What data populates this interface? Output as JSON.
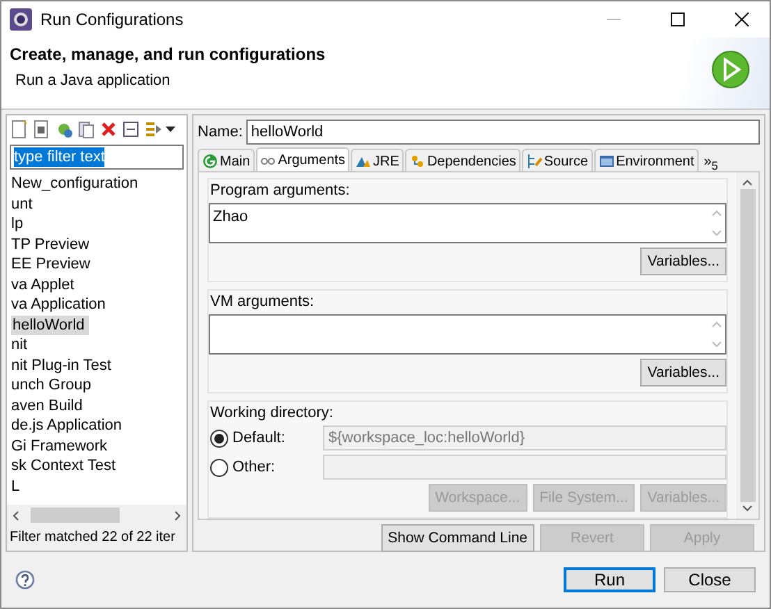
{
  "window": {
    "title": "Run Configurations"
  },
  "header": {
    "title": "Create, manage, and run configurations",
    "subtitle": "Run a Java application"
  },
  "sidebar": {
    "filter": {
      "placeholder": "type filter text"
    },
    "items": [
      {
        "label": "New_configuration",
        "selected": false
      },
      {
        "label": "unt",
        "selected": false
      },
      {
        "label": "lp",
        "selected": false
      },
      {
        "label": "TP Preview",
        "selected": false
      },
      {
        "label": "EE Preview",
        "selected": false
      },
      {
        "label": "va Applet",
        "selected": false
      },
      {
        "label": "va Application",
        "selected": false
      },
      {
        "label": "helloWorld",
        "selected": true
      },
      {
        "label": "nit",
        "selected": false
      },
      {
        "label": "nit Plug-in Test",
        "selected": false
      },
      {
        "label": "unch Group",
        "selected": false
      },
      {
        "label": "aven Build",
        "selected": false
      },
      {
        "label": "de.js Application",
        "selected": false
      },
      {
        "label": "Gi Framework",
        "selected": false
      },
      {
        "label": "sk Context Test",
        "selected": false
      },
      {
        "label": "L",
        "selected": false
      }
    ],
    "status": "Filter matched 22 of 22 iter"
  },
  "name_field": {
    "label": "Name:",
    "value": "helloWorld"
  },
  "tabs": [
    {
      "label": "Main",
      "selected": false
    },
    {
      "label": "Arguments",
      "selected": true
    },
    {
      "label": "JRE",
      "selected": false
    },
    {
      "label": "Dependencies",
      "selected": false
    },
    {
      "label": "Source",
      "selected": false
    },
    {
      "label": "Environment",
      "selected": false
    }
  ],
  "tabs_overflow": "»$_{5}$",
  "program_arguments": {
    "label": "Program arguments:",
    "value": "Zhao",
    "button": {
      "label": "Variables...",
      "disabled": false
    }
  },
  "vm_arguments": {
    "label": "VM arguments:",
    "button": {
      "label": "Variables...",
      "disabled": false
    }
  },
  "working_directory": {
    "label": "Working directory:",
    "options": [
      {
        "label": "Default:",
        "selected": true,
        "value": "${workspace_loc:helloWorld}"
      },
      {
        "label": "Other:",
        "selected": false
      }
    ],
    "buttons": [
      {
        "label": "Workspace...",
        "disabled": true
      },
      {
        "label": "File System...",
        "disabled": true
      },
      {
        "label": "Variables...",
        "disabled": true
      }
    ]
  },
  "panel_buttons": [
    {
      "label": "Show Command Line",
      "disabled": false
    },
    {
      "label": "Revert",
      "disabled": true
    },
    {
      "label": "Apply",
      "disabled": true
    }
  ],
  "dialog_buttons": [
    {
      "label": "Run",
      "default": true
    },
    {
      "label": "Close",
      "default": false
    }
  ]
}
